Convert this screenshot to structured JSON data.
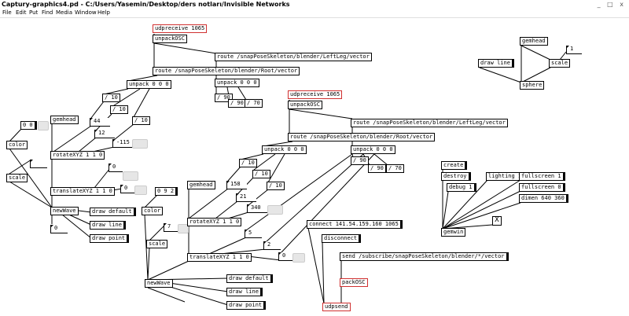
{
  "window": {
    "title": "Captury-graphics4.pd  - C:/Users/Yasemin/Desktop/ders notları/Invisible Networks",
    "controls": "_ □ x"
  },
  "menu": [
    "File",
    "Edit",
    "Put",
    "Find",
    "Media",
    "Window",
    "Help"
  ],
  "patch1": {
    "udpreceive": "udpreceive 1065",
    "unpackOSC": "unpackOSC",
    "route_left": "route /snapPoseSkeleton/blender/LeftLeg/vector",
    "route_root": "route /snapPoseSkeleton/blender/Root/vector",
    "unpack1": "unpack 0 0 0",
    "unpack2": "unpack 0 0 0",
    "div1": "/ 10",
    "div2": "/ 10",
    "div3": "/ 10",
    "num1": "44",
    "num2": "12",
    "num3": "-115",
    "div90a": "/ 90",
    "div90b": "/ 90",
    "div70": "/ 70",
    "gemhead": "gemhead",
    "num00": "0 0",
    "color": "color",
    "rotate": "rotateXYZ 1 1 0",
    "scale": "scale",
    "translate": "translateXYZ 1 1 0",
    "num0a": "0",
    "num0b": "0",
    "newWave": "newWave",
    "draw_default": "draw default",
    "draw_line": "draw line",
    "draw_point": "draw point",
    "num0c": "0"
  },
  "patch2": {
    "udpreceive": "udpreceive 1065",
    "unpackOSC": "unpackOSC",
    "route_left": "route /snapPoseSkeleton/blender/LeftLeg/vector",
    "route_root": "route /snapPoseSkeleton/blender/Root/vector",
    "unpack1": "unpack 0 0 0",
    "unpack2": "unpack 0 0 0",
    "div1": "/ 10",
    "div2": "/ 10",
    "div3": "/ 10",
    "num1": "158",
    "num2": "21",
    "num3": "340",
    "div90a": "/ 90",
    "div90b": "/ 90",
    "div70": "/ 70",
    "gemhead": "gemhead",
    "num02": "0 9 2",
    "color": "color",
    "num7": "7",
    "rotate": "rotateXYZ 1 1 0",
    "scale": "scale",
    "translate": "translateXYZ 1 1 0",
    "num5": "5",
    "num2b": "2",
    "num0": "0",
    "newWave": "newWave",
    "draw_default": "draw default",
    "draw_line": "draw line",
    "draw_point": "draw point"
  },
  "network": {
    "connect": "connect 141.54.159.160 1065",
    "disconnect": "disconnect",
    "send": "send /subscribe/snapPoseSkeleton/blender/*/vector",
    "packOSC": "packOSC",
    "udpsend": "udpsend"
  },
  "sphere_patch": {
    "gemhead": "gemhead",
    "draw_line": "draw line",
    "scale": "scale",
    "num1": "1",
    "sphere": "sphere"
  },
  "gemwin_patch": {
    "create": "create",
    "destroy": "destroy",
    "debug": "debug 1",
    "lighting": "lighting 1",
    "fullscreen1": "fullscreen 1",
    "fullscreen0": "fullscreen 0",
    "dimen": "dimen 640 360",
    "gemwin": "gemwin",
    "toggle_mark": "X"
  }
}
